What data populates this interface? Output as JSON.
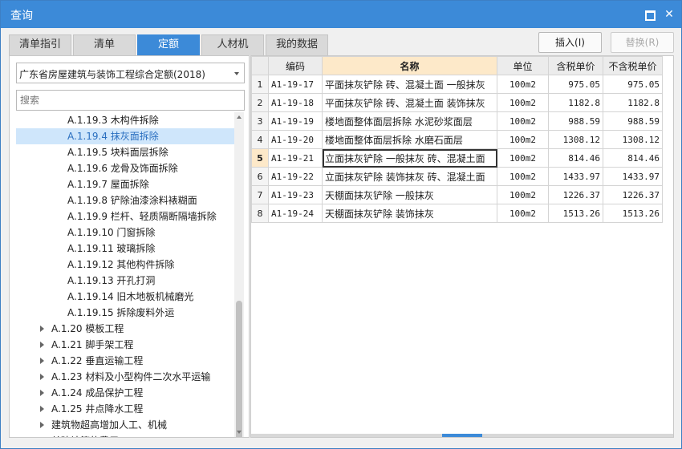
{
  "window": {
    "title": "查询"
  },
  "tabs": [
    {
      "label": "清单指引"
    },
    {
      "label": "清单"
    },
    {
      "label": "定额",
      "active": true
    },
    {
      "label": "人材机"
    },
    {
      "label": "我的数据"
    }
  ],
  "actions": {
    "insert_label": "插入(I)",
    "replace_label": "替换(R)"
  },
  "library": {
    "selected": "广东省房屋建筑与装饰工程综合定额(2018)"
  },
  "search": {
    "placeholder": "搜索"
  },
  "tree": {
    "items": [
      {
        "label": "A.1.19.3 木构件拆除",
        "level": 2,
        "expandable": false
      },
      {
        "label": "A.1.19.4 抹灰面拆除",
        "level": 2,
        "expandable": false,
        "selected": true
      },
      {
        "label": "A.1.19.5 块料面层拆除",
        "level": 2,
        "expandable": false
      },
      {
        "label": "A.1.19.6 龙骨及饰面拆除",
        "level": 2,
        "expandable": false
      },
      {
        "label": "A.1.19.7 屋面拆除",
        "level": 2,
        "expandable": false
      },
      {
        "label": "A.1.19.8 铲除油漆涂料裱糊面",
        "level": 2,
        "expandable": false
      },
      {
        "label": "A.1.19.9 栏杆、轻质隔断隔墙拆除",
        "level": 2,
        "expandable": false
      },
      {
        "label": "A.1.19.10 门窗拆除",
        "level": 2,
        "expandable": false
      },
      {
        "label": "A.1.19.11 玻璃拆除",
        "level": 2,
        "expandable": false
      },
      {
        "label": "A.1.19.12 其他构件拆除",
        "level": 2,
        "expandable": false
      },
      {
        "label": "A.1.19.13 开孔打洞",
        "level": 2,
        "expandable": false
      },
      {
        "label": "A.1.19.14 旧木地板机械磨光",
        "level": 2,
        "expandable": false
      },
      {
        "label": "A.1.19.15 拆除废料外运",
        "level": 2,
        "expandable": false
      },
      {
        "label": "A.1.20 模板工程",
        "level": 1,
        "expandable": true
      },
      {
        "label": "A.1.21 脚手架工程",
        "level": 1,
        "expandable": true
      },
      {
        "label": "A.1.22 垂直运输工程",
        "level": 1,
        "expandable": true
      },
      {
        "label": "A.1.23 材料及小型构件二次水平运输",
        "level": 1,
        "expandable": true
      },
      {
        "label": "A.1.24 成品保护工程",
        "level": 1,
        "expandable": true
      },
      {
        "label": "A.1.25 井点降水工程",
        "level": 1,
        "expandable": true
      },
      {
        "label": "建筑物超高增加人工、机械",
        "level": 1,
        "expandable": true
      },
      {
        "label": "单独计算的费用",
        "level": 1,
        "expandable": true
      }
    ]
  },
  "table": {
    "columns": [
      "编码",
      "名称",
      "单位",
      "含税单价",
      "不含税单价"
    ],
    "sorted_column": "名称",
    "current_row": 5,
    "rows": [
      {
        "no": "1",
        "code": "A1-19-17",
        "name": "平面抹灰铲除 砖、混凝土面 一般抹灰",
        "unit": "100m2",
        "price_tax": "975.05",
        "price_notax": "975.05"
      },
      {
        "no": "2",
        "code": "A1-19-18",
        "name": "平面抹灰铲除 砖、混凝土面 装饰抹灰",
        "unit": "100m2",
        "price_tax": "1182.8",
        "price_notax": "1182.8"
      },
      {
        "no": "3",
        "code": "A1-19-19",
        "name": "楼地面整体面层拆除 水泥砂浆面层",
        "unit": "100m2",
        "price_tax": "988.59",
        "price_notax": "988.59"
      },
      {
        "no": "4",
        "code": "A1-19-20",
        "name": "楼地面整体面层拆除 水磨石面层",
        "unit": "100m2",
        "price_tax": "1308.12",
        "price_notax": "1308.12"
      },
      {
        "no": "5",
        "code": "A1-19-21",
        "name": "立面抹灰铲除 一般抹灰 砖、混凝土面",
        "unit": "100m2",
        "price_tax": "814.46",
        "price_notax": "814.46"
      },
      {
        "no": "6",
        "code": "A1-19-22",
        "name": "立面抹灰铲除 装饰抹灰 砖、混凝土面",
        "unit": "100m2",
        "price_tax": "1433.97",
        "price_notax": "1433.97"
      },
      {
        "no": "7",
        "code": "A1-19-23",
        "name": "天棚面抹灰铲除 一般抹灰",
        "unit": "100m2",
        "price_tax": "1226.37",
        "price_notax": "1226.37"
      },
      {
        "no": "8",
        "code": "A1-19-24",
        "name": "天棚面抹灰铲除 装饰抹灰",
        "unit": "100m2",
        "price_tax": "1513.26",
        "price_notax": "1513.26"
      }
    ]
  },
  "colors": {
    "accent": "#3c8ad8",
    "selected_bg": "#cfe6fb",
    "header_highlight": "#fde9c9"
  }
}
